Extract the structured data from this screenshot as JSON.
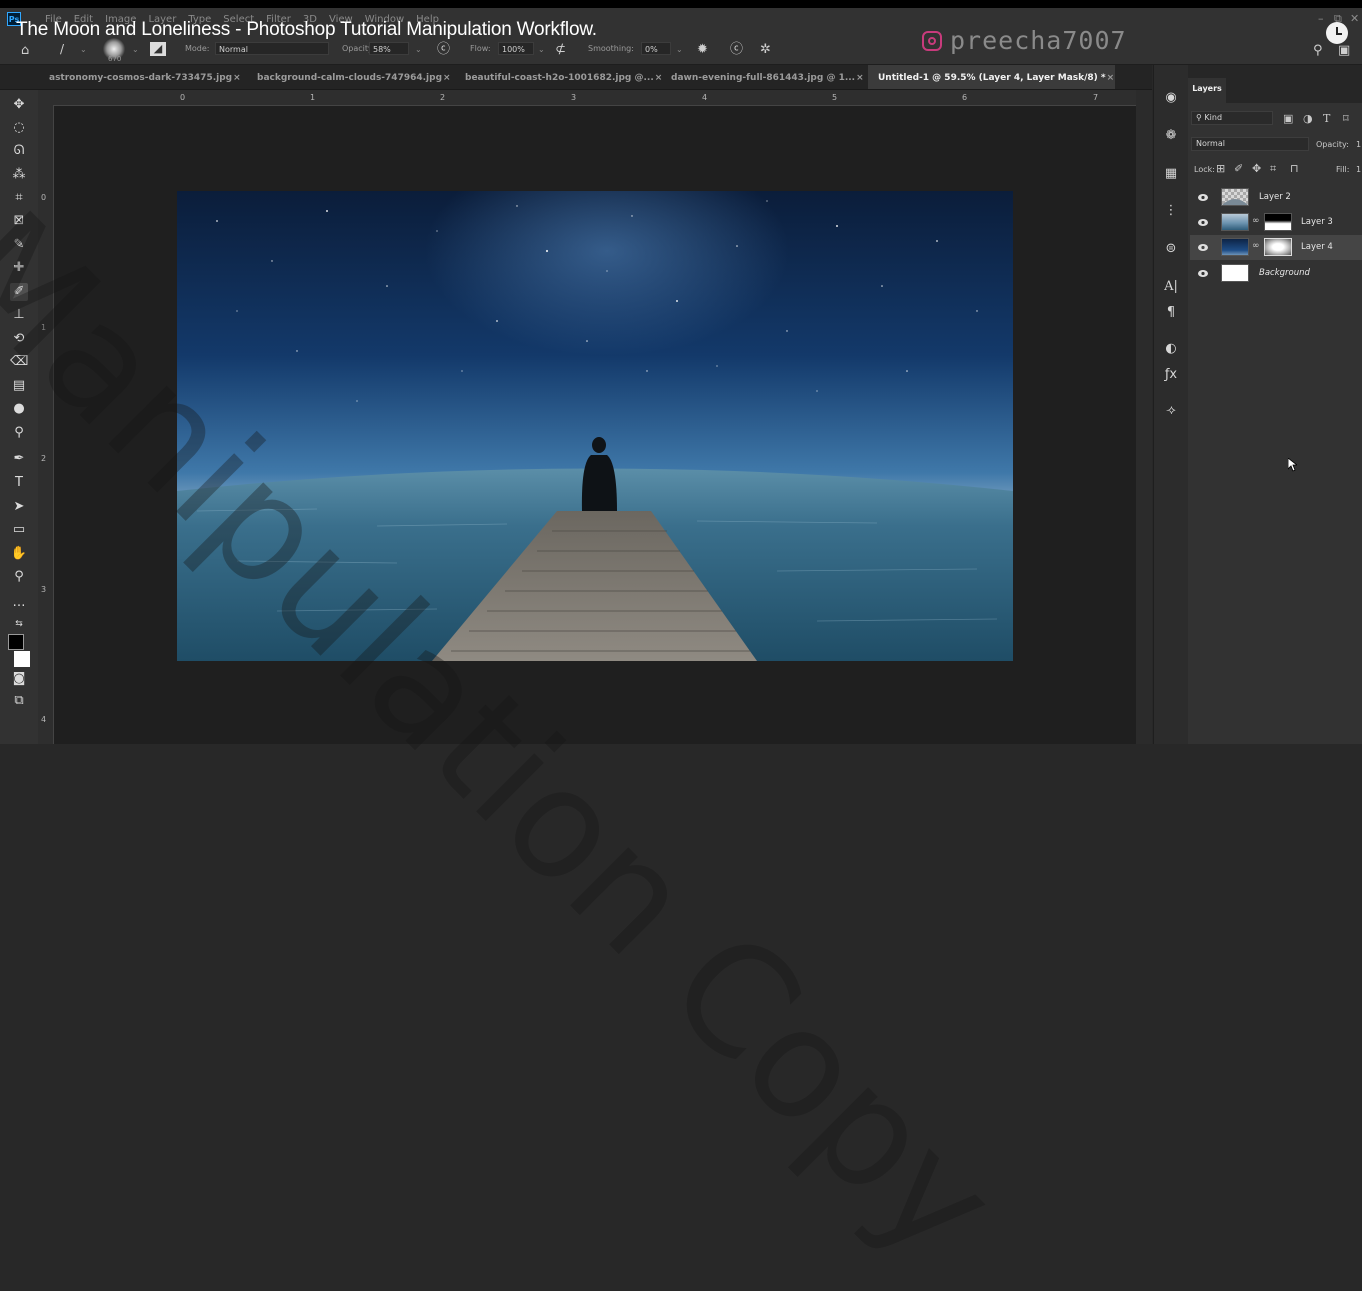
{
  "video_title": "The Moon and Loneliness - Photoshop Tutorial Manipulation Workflow.",
  "watermark": {
    "handle": "preecha7007",
    "overlay_text": "Manipulation Copy"
  },
  "app": {
    "logo_text": "Ps"
  },
  "menu": [
    "File",
    "Edit",
    "Image",
    "Layer",
    "Type",
    "Select",
    "Filter",
    "3D",
    "View",
    "Window",
    "Help"
  ],
  "options_bar": {
    "brush_size": "670",
    "mode_label": "Mode:",
    "mode_value": "Normal",
    "opacity_label": "Opacity:",
    "opacity_value": "58%",
    "flow_label": "Flow:",
    "flow_value": "100%",
    "smoothing_label": "Smoothing:",
    "smoothing_value": "0%"
  },
  "tabs": [
    {
      "label": "astronomy-cosmos-dark-733475.jpg",
      "close": "×",
      "active": false
    },
    {
      "label": "background-calm-clouds-747964.jpg",
      "close": "×",
      "active": false
    },
    {
      "label": "beautiful-coast-h2o-1001682.jpg @...",
      "close": "×",
      "active": false
    },
    {
      "label": "dawn-evening-full-861443.jpg @ 1...",
      "close": "×",
      "active": false
    },
    {
      "label": "Untitled-1 @ 59.5% (Layer 4, Layer Mask/8) *",
      "close": "×",
      "active": true
    }
  ],
  "ruler": {
    "h_ticks": [
      "0",
      "1",
      "2",
      "3",
      "4",
      "5",
      "6",
      "7"
    ],
    "v_ticks": [
      "0",
      "1",
      "2",
      "3",
      "4"
    ]
  },
  "layers_panel": {
    "tab_label": "Layers",
    "filter_kind": "Kind",
    "blend_mode": "Normal",
    "opacity_label": "Opacity:",
    "opacity_value": "1",
    "lock_label": "Lock:",
    "fill_label": "Fill:",
    "fill_value": "1",
    "layers": [
      {
        "name": "Layer 2",
        "visible": true,
        "selected": false,
        "has_mask": false,
        "italic": false
      },
      {
        "name": "Layer 3",
        "visible": true,
        "selected": false,
        "has_mask": true,
        "italic": false
      },
      {
        "name": "Layer 4",
        "visible": true,
        "selected": true,
        "has_mask": true,
        "italic": false
      },
      {
        "name": "Background",
        "visible": true,
        "selected": false,
        "has_mask": false,
        "italic": true
      }
    ]
  },
  "colors": {
    "ui_dark": "#323232",
    "workspace": "#1f1f1f",
    "accent": "#31a8ff",
    "instagram": "#c83b7c"
  }
}
